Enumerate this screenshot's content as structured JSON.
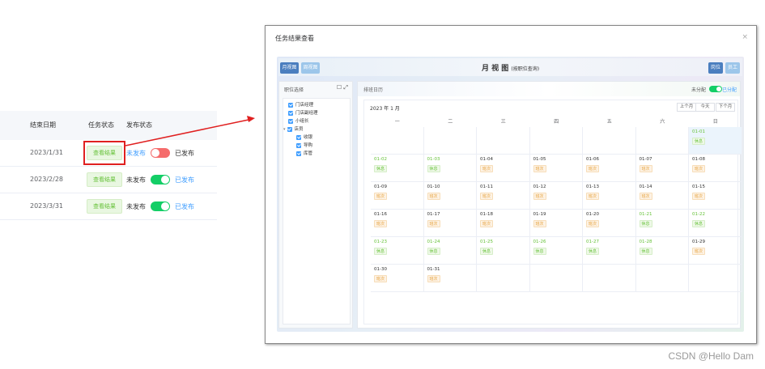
{
  "task_table": {
    "headers": {
      "end_date": "结束日期",
      "task_status": "任务状态",
      "publish_status": "发布状态"
    },
    "rows": [
      {
        "end_date": "2023/1/31",
        "button": "查看结果",
        "unpublished": "未发布",
        "published": "已发布",
        "state": "unpublished"
      },
      {
        "end_date": "2023/2/28",
        "button": "查看结果",
        "unpublished": "未发布",
        "published": "已发布",
        "state": "published"
      },
      {
        "end_date": "2023/3/31",
        "button": "查看结果",
        "unpublished": "未发布",
        "published": "已发布",
        "state": "published"
      }
    ]
  },
  "dialog": {
    "title": "任务结果查看",
    "close": "×",
    "buttons": {
      "month_view": "月视图",
      "week_view": "周视图",
      "post": "岗位",
      "employee": "员工"
    },
    "month_title": "月 视 图",
    "month_subtitle": "(按职位查询)",
    "sidebar": {
      "title": "职位选择",
      "icons": "☐ ⤢",
      "tree": [
        {
          "label": "门店经理",
          "level": 0
        },
        {
          "label": "门店副经理",
          "level": 0
        },
        {
          "label": "小组长",
          "level": 0
        },
        {
          "label": "店员",
          "level": 0,
          "expanded": true
        },
        {
          "label": "收银",
          "level": 1
        },
        {
          "label": "导购",
          "level": 1
        },
        {
          "label": "库管",
          "level": 1
        }
      ]
    },
    "calendar": {
      "panel_title": "排班日历",
      "toggle_label": "未分配",
      "toggle_on": "已分配",
      "month": "2023 年 1 月",
      "nav": {
        "prev": "上个月",
        "today": "今天",
        "next": "下个月"
      },
      "weekdays": [
        "一",
        "二",
        "三",
        "四",
        "五",
        "六",
        "日"
      ],
      "weeks": [
        [
          null,
          null,
          null,
          null,
          null,
          null,
          {
            "date": "01-01",
            "tag": "休息",
            "type": "rest",
            "today": true
          }
        ],
        [
          {
            "date": "01-02",
            "tag": "休息",
            "type": "rest"
          },
          {
            "date": "01-03",
            "tag": "休息",
            "type": "rest"
          },
          {
            "date": "01-04",
            "tag": "班次",
            "type": "work"
          },
          {
            "date": "01-05",
            "tag": "班次",
            "type": "work"
          },
          {
            "date": "01-06",
            "tag": "班次",
            "type": "work"
          },
          {
            "date": "01-07",
            "tag": "班次",
            "type": "work"
          },
          {
            "date": "01-08",
            "tag": "班次",
            "type": "work"
          }
        ],
        [
          {
            "date": "01-09",
            "tag": "班次",
            "type": "work"
          },
          {
            "date": "01-10",
            "tag": "班次",
            "type": "work"
          },
          {
            "date": "01-11",
            "tag": "班次",
            "type": "work"
          },
          {
            "date": "01-12",
            "tag": "班次",
            "type": "work"
          },
          {
            "date": "01-13",
            "tag": "班次",
            "type": "work"
          },
          {
            "date": "01-14",
            "tag": "班次",
            "type": "work"
          },
          {
            "date": "01-15",
            "tag": "班次",
            "type": "work"
          }
        ],
        [
          {
            "date": "01-16",
            "tag": "班次",
            "type": "work"
          },
          {
            "date": "01-17",
            "tag": "班次",
            "type": "work"
          },
          {
            "date": "01-18",
            "tag": "班次",
            "type": "work"
          },
          {
            "date": "01-19",
            "tag": "班次",
            "type": "work"
          },
          {
            "date": "01-20",
            "tag": "班次",
            "type": "work"
          },
          {
            "date": "01-21",
            "tag": "休息",
            "type": "rest"
          },
          {
            "date": "01-22",
            "tag": "休息",
            "type": "rest"
          }
        ],
        [
          {
            "date": "01-23",
            "tag": "休息",
            "type": "rest"
          },
          {
            "date": "01-24",
            "tag": "休息",
            "type": "rest"
          },
          {
            "date": "01-25",
            "tag": "休息",
            "type": "rest"
          },
          {
            "date": "01-26",
            "tag": "休息",
            "type": "rest"
          },
          {
            "date": "01-27",
            "tag": "休息",
            "type": "rest"
          },
          {
            "date": "01-28",
            "tag": "休息",
            "type": "rest"
          },
          {
            "date": "01-29",
            "tag": "班次",
            "type": "work"
          }
        ],
        [
          {
            "date": "01-30",
            "tag": "班次",
            "type": "work"
          },
          {
            "date": "01-31",
            "tag": "班次",
            "type": "work"
          },
          null,
          null,
          null,
          null,
          null
        ]
      ]
    }
  },
  "colors": {
    "highlight": "#e02020",
    "primary": "#409eff",
    "success": "#67c23a",
    "warning": "#e6a23c"
  },
  "watermark": "CSDN @Hello Dam"
}
